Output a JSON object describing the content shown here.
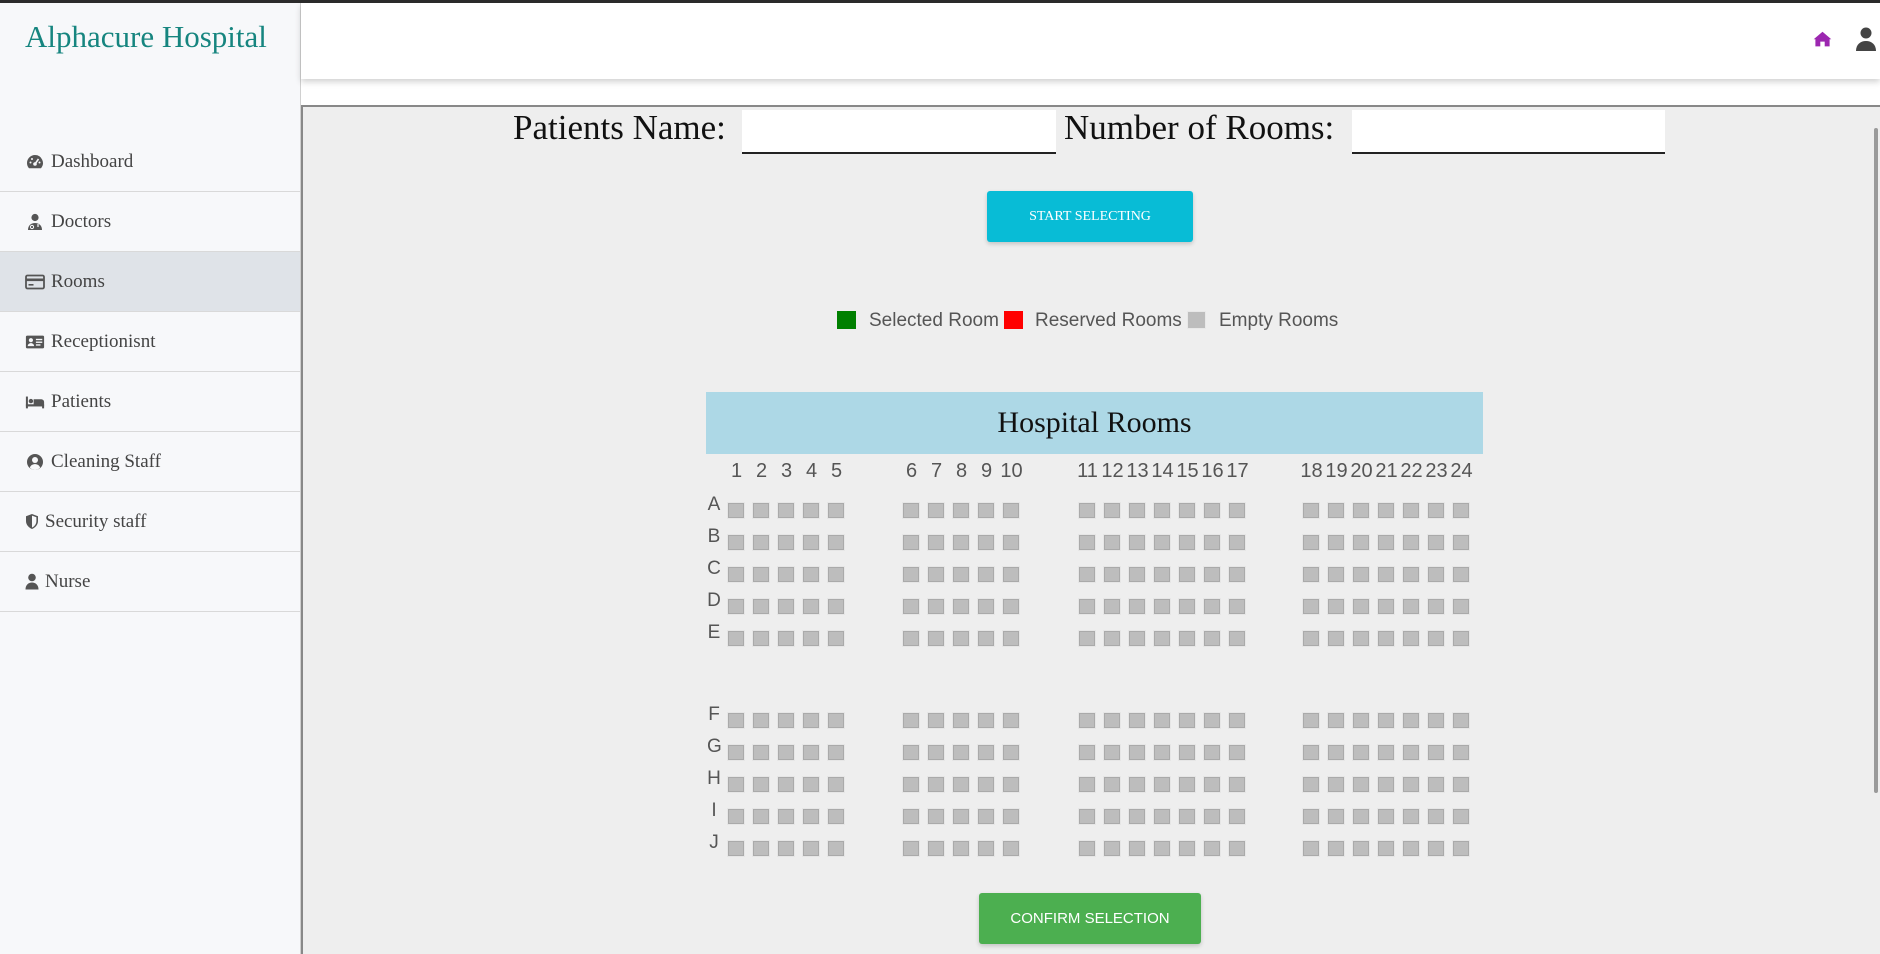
{
  "app": {
    "title": "Alphacure Hospital"
  },
  "sidebar": {
    "items": [
      {
        "label": "Dashboard",
        "icon": "dashboard-icon"
      },
      {
        "label": "Doctors",
        "icon": "doctor-icon"
      },
      {
        "label": "Rooms",
        "icon": "credit-card-icon",
        "active": true
      },
      {
        "label": "Receptionisnt",
        "icon": "id-card-icon"
      },
      {
        "label": "Patients",
        "icon": "bed-icon"
      },
      {
        "label": "Cleaning Staff",
        "icon": "user-circle-icon"
      },
      {
        "label": "Security staff",
        "icon": "shield-icon"
      },
      {
        "label": "Nurse",
        "icon": "user-icon"
      }
    ]
  },
  "header": {
    "icons": [
      "home-icon",
      "user-icon"
    ],
    "home_color": "#9c27b0"
  },
  "form": {
    "patient_name_label": "Patients Name:",
    "patient_name_value": "",
    "rooms_label": "Number of Rooms:",
    "rooms_value": ""
  },
  "buttons": {
    "start": "Start Selecting",
    "confirm": "Confirm Selection"
  },
  "legend": {
    "selected": "Selected Room",
    "reserved": "Reserved Rooms",
    "empty": "Empty Rooms",
    "colors": {
      "selected": "#008000",
      "reserved": "#ff0000",
      "empty": "#bdbdbd"
    }
  },
  "rooms": {
    "title": "Hospital Rooms",
    "columns": [
      "1",
      "2",
      "3",
      "4",
      "5",
      "6",
      "7",
      "8",
      "9",
      "10",
      "11",
      "12",
      "13",
      "14",
      "15",
      "16",
      "17",
      "18",
      "19",
      "20",
      "21",
      "22",
      "23",
      "24"
    ],
    "rows": [
      "A",
      "B",
      "C",
      "D",
      "E",
      "F",
      "G",
      "H",
      "I",
      "J"
    ],
    "selected": [],
    "reserved": []
  }
}
